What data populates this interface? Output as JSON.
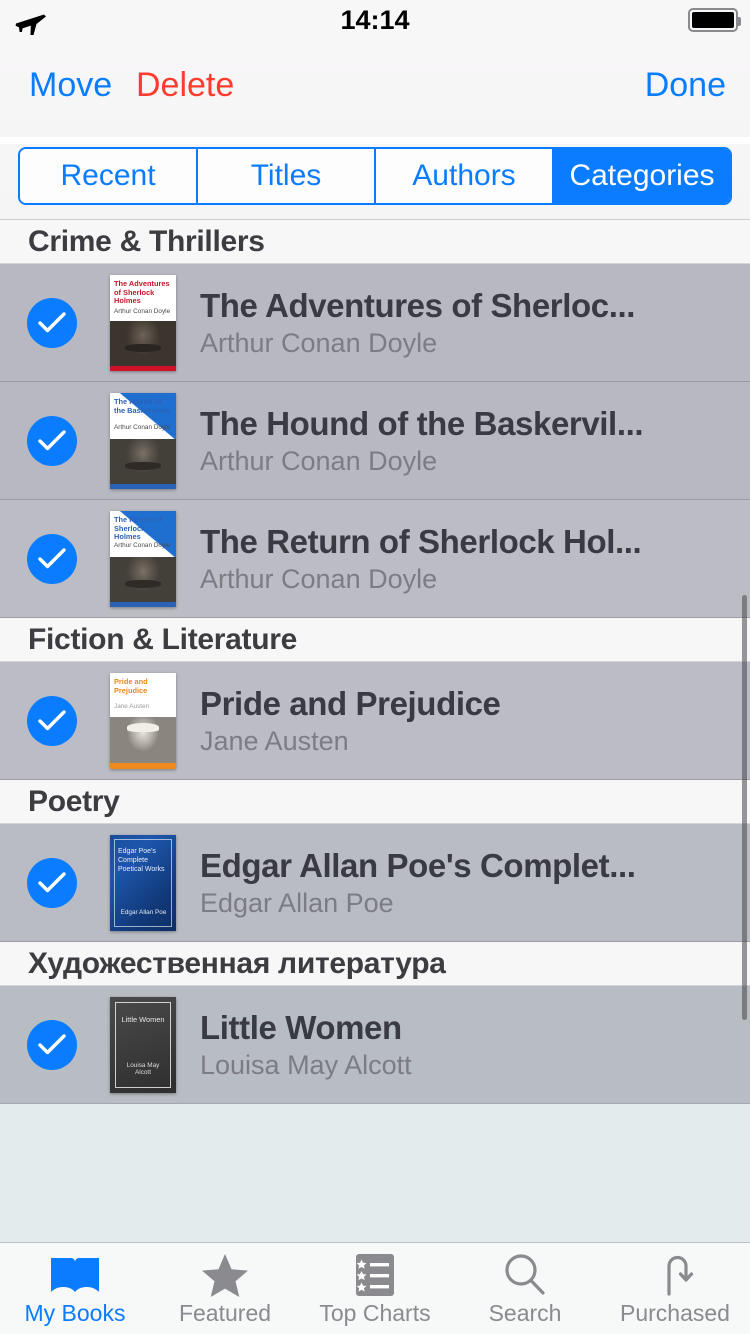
{
  "status_bar": {
    "airplane_icon": "airplane-mode-icon",
    "time": "14:14",
    "battery_icon": "battery-full-icon"
  },
  "nav_bar": {
    "move_label": "Move",
    "delete_label": "Delete",
    "done_label": "Done"
  },
  "segmented_control": {
    "options": [
      "Recent",
      "Titles",
      "Authors",
      "Categories"
    ],
    "selected": "Categories",
    "accent_color": "#0a7cff"
  },
  "sections": [
    {
      "title": "Crime & Thrillers",
      "books": [
        {
          "title": "The Adventures of Sherloc...",
          "author": "Arthur Conan Doyle",
          "selected": true,
          "cover": {
            "style": "cv-white",
            "title_text": "The Adventures of Sherlock Holmes",
            "author_text": "Arthur Conan Doyle"
          }
        },
        {
          "title": "The Hound of the Baskervil...",
          "author": "Arthur Conan Doyle",
          "selected": true,
          "cover": {
            "style": "cv-blue",
            "title_text": "The Hound of the Baskervilles",
            "author_text": "Arthur Conan Doyle"
          }
        },
        {
          "title": "The Return of Sherlock Hol...",
          "author": "Arthur Conan Doyle",
          "selected": true,
          "cover": {
            "style": "cv-blue",
            "title_text": "The Return of Sherlock Holmes",
            "author_text": "Arthur Conan Doyle"
          }
        }
      ]
    },
    {
      "title": "Fiction & Literature",
      "books": [
        {
          "title": "Pride and Prejudice",
          "author": "Jane Austen",
          "selected": true,
          "cover": {
            "style": "cv-orange",
            "title_text": "Pride and Prejudice",
            "author_text": "Jane Austen"
          }
        }
      ]
    },
    {
      "title": "Poetry",
      "books": [
        {
          "title": "Edgar Allan Poe's Complet...",
          "author": "Edgar Allan Poe",
          "selected": true,
          "cover": {
            "style": "cv-navy",
            "title_text": "Edgar Poe's Complete Poetical Works",
            "author_text": "Edgar Allan Poe"
          }
        }
      ]
    },
    {
      "title": "Художественная литература",
      "books": [
        {
          "title": "Little Women",
          "author": "Louisa May Alcott",
          "selected": true,
          "cover": {
            "style": "cv-dark",
            "title_text": "Little Women",
            "author_text": "Louisa May Alcott"
          }
        }
      ]
    }
  ],
  "tab_bar": {
    "tabs": [
      {
        "label": "My Books",
        "icon": "open-book-icon",
        "active": true
      },
      {
        "label": "Featured",
        "icon": "star-icon",
        "active": false
      },
      {
        "label": "Top Charts",
        "icon": "list-chart-icon",
        "active": false
      },
      {
        "label": "Search",
        "icon": "magnifier-icon",
        "active": false
      },
      {
        "label": "Purchased",
        "icon": "download-loop-icon",
        "active": false
      }
    ],
    "active_color": "#0a7cff",
    "inactive_color": "#8a8a8f"
  }
}
